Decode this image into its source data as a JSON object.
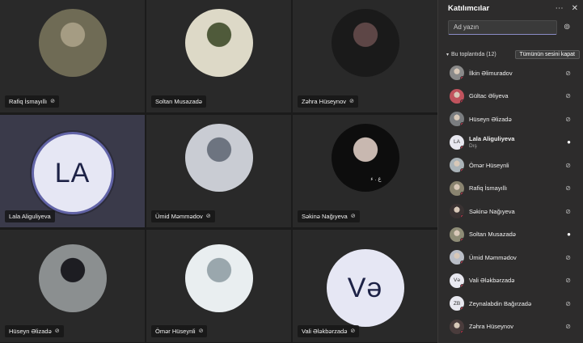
{
  "grid": {
    "tiles": [
      {
        "name": "Rafiq İsmayıllı",
        "muted": true,
        "kind": "photo",
        "colors": [
          "#6f6b55",
          "#a59c83"
        ]
      },
      {
        "name": "Soltan Musazadə",
        "muted": false,
        "kind": "photo",
        "colors": [
          "#ddd9c7",
          "#4f5a3a"
        ]
      },
      {
        "name": "Zəhra Hüseynov",
        "muted": true,
        "kind": "photo",
        "colors": [
          "#1a1a1a",
          "#5d4646"
        ]
      },
      {
        "name": "Lala Aliguliyeva",
        "muted": false,
        "kind": "initials",
        "initials": "LA"
      },
      {
        "name": "Ümid Məmmədov",
        "muted": true,
        "kind": "photo",
        "colors": [
          "#c9ccd3",
          "#6d7480"
        ]
      },
      {
        "name": "Səkinə Nağıyeva",
        "muted": true,
        "kind": "photo",
        "colors": [
          "#0d0d0d",
          "#c8b8b0"
        ],
        "watermark": "ع . ﺀ"
      },
      {
        "name": "Hüseyn Əlizadə",
        "muted": true,
        "kind": "photo",
        "colors": [
          "#8b8f90",
          "#1d1d22"
        ]
      },
      {
        "name": "Ömər Hüseynli",
        "muted": true,
        "kind": "photo",
        "colors": [
          "#e9eef0",
          "#9aa7ad"
        ]
      },
      {
        "name": "Vali Ələkbərzadə",
        "muted": true,
        "kind": "initials",
        "initials": "Və"
      }
    ]
  },
  "panel": {
    "title": "Katılımcılar",
    "more_icon": "more-icon",
    "close_icon": "close-icon",
    "search_placeholder": "Ad yazın",
    "section_label": "Bu toplantıda (12)",
    "mute_all_label": "Tümünün sesini kapat",
    "participants": [
      {
        "name": "İlkin Əlimuradov",
        "role": "",
        "mic": "off",
        "avatar": "photo",
        "color": "#8a8a8a"
      },
      {
        "name": "Gültac Əliyeva",
        "role": "",
        "mic": "off",
        "avatar": "photo",
        "color": "#c0535d"
      },
      {
        "name": "Hüseyn Əlizadə",
        "role": "",
        "mic": "off",
        "avatar": "photo",
        "color": "#7a7d80"
      },
      {
        "name": "Lala Aliguliyeva",
        "role": "Dış",
        "mic": "on",
        "avatar": "initials",
        "initials": "LA",
        "color": "#e6e7f4"
      },
      {
        "name": "Ömər Hüseynli",
        "role": "",
        "mic": "off",
        "avatar": "photo",
        "color": "#aab3b8"
      },
      {
        "name": "Rafiq İsmayıllı",
        "role": "",
        "mic": "off",
        "avatar": "photo",
        "color": "#8a8470"
      },
      {
        "name": "Səkinə Nağıyeva",
        "role": "",
        "mic": "off",
        "avatar": "photo",
        "color": "#3a3232"
      },
      {
        "name": "Soltan Musazadə",
        "role": "",
        "mic": "on",
        "avatar": "photo",
        "color": "#8e8c76"
      },
      {
        "name": "Ümid Məmmədov",
        "role": "",
        "mic": "off",
        "avatar": "photo",
        "color": "#b9bdc6"
      },
      {
        "name": "Vali Ələkbərzadə",
        "role": "",
        "mic": "off",
        "avatar": "initials",
        "initials": "Və",
        "color": "#e6e7f4"
      },
      {
        "name": "Zeynalabdin Bağırzadə",
        "role": "",
        "mic": "off",
        "avatar": "initials",
        "initials": "ZB",
        "color": "#e6e7f4"
      },
      {
        "name": "Zəhra Hüseynov",
        "role": "",
        "mic": "off",
        "avatar": "photo",
        "color": "#4a3c3c"
      }
    ]
  }
}
